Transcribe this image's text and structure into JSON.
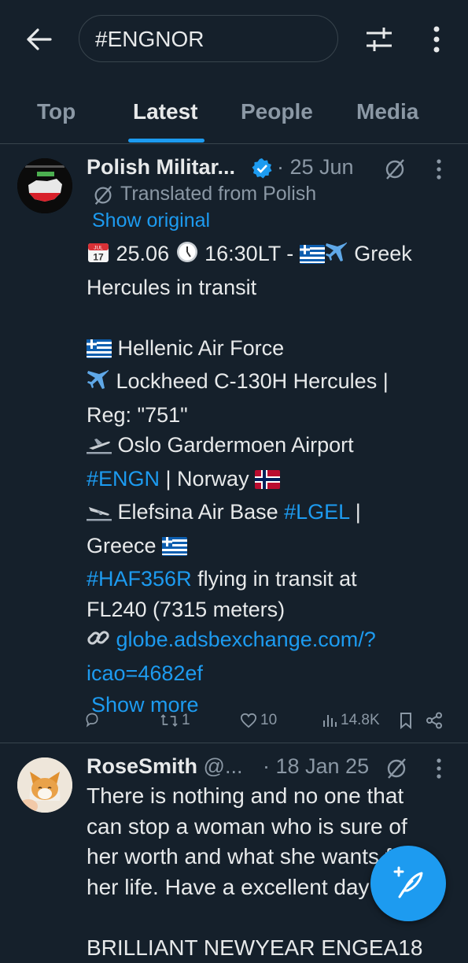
{
  "search": {
    "query": "#ENGNOR"
  },
  "tabs": [
    "Top",
    "Latest",
    "People",
    "Media"
  ],
  "tweets": [
    {
      "author": "Polish Militar...",
      "verified": true,
      "date": "· 25 Jun",
      "translated_label": "Translated from Polish",
      "show_original": "Show original",
      "line1": "25.06",
      "line1b": "16:30LT -",
      "line1c": "Greek",
      "line2": "Hercules in transit",
      "line3": "Hellenic Air Force",
      "line4": "Lockheed C-130H Hercules |",
      "line5": "Reg: \"751\"",
      "line6": "Oslo Gardermoen Airport",
      "line7_tag": "#ENGN",
      "line7_rest": " | Norway",
      "line8": "Elefsina Air Base",
      "line8_tag": "#LGEL",
      "line8_rest": " |",
      "line9": "Greece",
      "line10_tag": "#HAF356R",
      "line10_rest": " flying in transit at",
      "line11": "FL240 (7315 meters)",
      "line12_link": "globe.adsbexchange.com/?",
      "line13_link": "icao=4682ef",
      "show_more": "Show more",
      "calendar_month": "JUL",
      "calendar_day": "17",
      "retweets": "1",
      "likes": "10",
      "views": "14.8K"
    },
    {
      "author": "RoseSmith",
      "handle": "@...",
      "date": "· 18 Jan 25",
      "line1": "There is nothing and no one that",
      "line2": "can stop a woman who is sure of",
      "line3": "her worth and what she wants for",
      "line4": "her life. Have a excellent day",
      "line5": "BRILLIANT NEWYEAR ENGEA18"
    }
  ],
  "colors": {
    "background": "#15202b",
    "accent": "#1d9bf0",
    "muted": "#8b98a5",
    "text": "#e7e9ea"
  }
}
